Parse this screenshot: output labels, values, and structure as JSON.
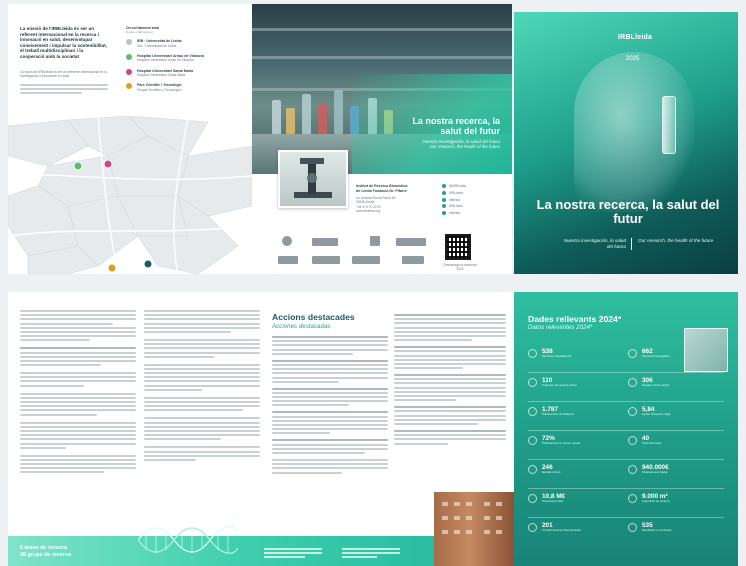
{
  "intro": {
    "heading": "La missió de l'IRBLleida és ser un referent internacional en la recerca i innovació en salut, desenvolupar coneixement i impulsar la sostenibilitat, el treball multidisciplinari i la cooperació amb la societat",
    "sub": "La visión del IRBLleida es ser un referente internacional en la investigación e innovación en salut"
  },
  "legend": {
    "title": "On col·laborem amb",
    "subtitle": "Dónde colaboramos",
    "items": [
      {
        "label": "IRB · Universitat de Lleida",
        "sub": "UdL · Universidad de Lleida",
        "color": "#b9c3c8"
      },
      {
        "label": "Hospital Universitari Arnau de Vilanova",
        "sub": "Hospital Universitario Arnau de Vilanova",
        "color": "#5bbf6a"
      },
      {
        "label": "Hospital Universitari Santa Maria",
        "sub": "Hospital Universitario Santa Maria",
        "color": "#c74a86"
      },
      {
        "label": "Parc Científic i Tecnològic",
        "sub": "Parque Científico y Tecnológico",
        "color": "#d8a21f"
      }
    ]
  },
  "contact": {
    "photo_title": "La nostra recerca, la salut del futur",
    "photo_sub_es": "Nuestra investigación, la salud del futuro",
    "photo_sub_en": "Our research, the health of the future",
    "institute": [
      "Institut de Recerca Biomèdica",
      "de Lleida Fundació Dr. Pifarré",
      "Av. Alcalde Rovira Roure 80",
      "25198 Lleida",
      "+34 973 70 22 00",
      "www.irblleida.org"
    ],
    "social": [
      "@IRBLleida",
      "IRBLleida",
      "irblleida",
      "IRBLleida",
      "irblleida"
    ],
    "qr_caption": "Descarrega la memòria 2024"
  },
  "cover": {
    "logo": "IRBLleida",
    "year": "2025",
    "title": "La nostra recerca, la salut del futur",
    "sub_es": "Nuestra investigación, la salud del futuro",
    "sub_en": "Our research, the health of the future"
  },
  "spread": {
    "heading": "Accions destacades",
    "heading_es": "Acciones destacadas",
    "band_line1": "5 àrees de recerca",
    "band_line2": "36 grups de recerca"
  },
  "data": {
    "title": "Dades rellevants 2024*",
    "subtitle": "Datos relevantes 2024*",
    "stats": [
      {
        "value": "538",
        "label": "Persones treballadores"
      },
      {
        "value": "662",
        "label": "Personal investigador"
      },
      {
        "value": "110",
        "label": "Projectes de recerca actius"
      },
      {
        "value": "306",
        "label": "Assajos clínics actius"
      },
      {
        "value": "1.787",
        "label": "Publicacions científiques"
      },
      {
        "value": "5,84",
        "label": "Factor d'impacte mitjà"
      },
      {
        "value": "72%",
        "label": "Publicacions en primer quartil"
      },
      {
        "value": "40",
        "label": "Tesis doctorals"
      },
      {
        "value": "246",
        "label": "Estudis clínics"
      },
      {
        "value": "940.000€",
        "label": "Finançament captat"
      },
      {
        "value": "10,8 M€",
        "label": "Pressupost total"
      },
      {
        "value": "9.000 m²",
        "label": "Superfície de recerca"
      },
      {
        "value": "201",
        "label": "Col·laboracions internacionals"
      },
      {
        "value": "535",
        "label": "Estudiants en formació"
      }
    ]
  }
}
